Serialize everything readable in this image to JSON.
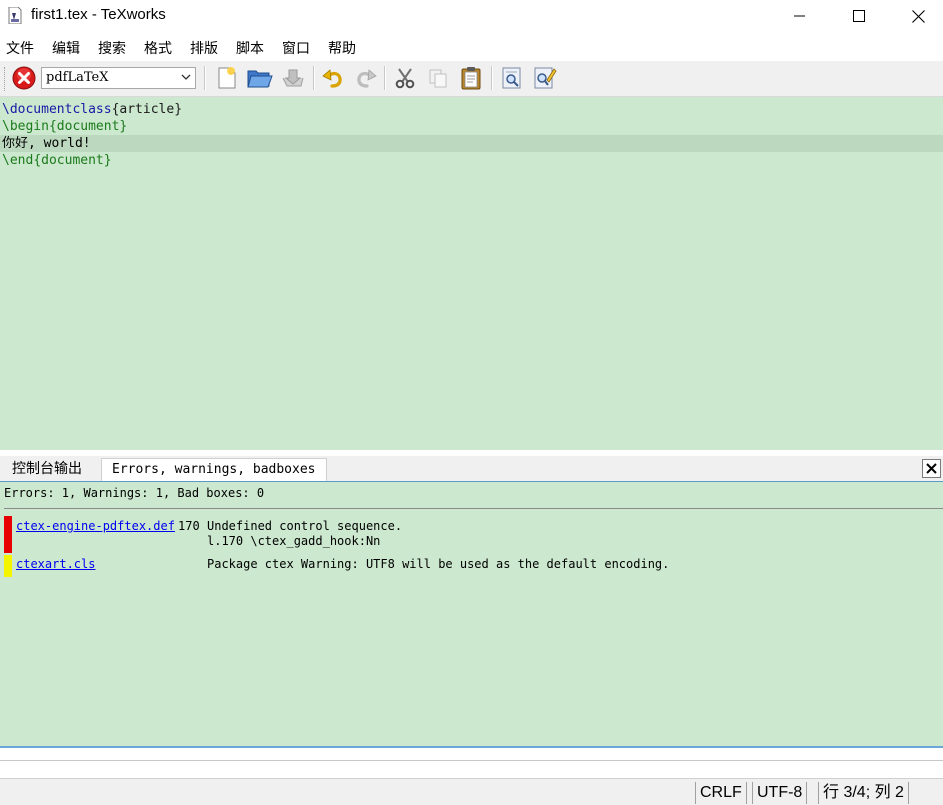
{
  "window": {
    "title": "first1.tex - TeXworks"
  },
  "menu": [
    "文件",
    "编辑",
    "搜索",
    "格式",
    "排版",
    "脚本",
    "窗口",
    "帮助"
  ],
  "toolbar": {
    "engine": "pdfLaTeX",
    "icons": [
      "stop-typeset-icon",
      "new-document-icon",
      "open-folder-icon",
      "save-icon",
      "undo-icon",
      "redo-icon",
      "cut-icon",
      "copy-icon",
      "paste-icon",
      "find-icon",
      "replace-icon"
    ]
  },
  "editor": {
    "lines": [
      {
        "cmd": "\\documentclass",
        "arg": "{article}"
      },
      {
        "cmd": "\\begin",
        "arg": "{document}"
      },
      {
        "text": "你好, world!"
      },
      {
        "cmd": "\\end",
        "arg": "{document}"
      }
    ]
  },
  "panel": {
    "tabs": [
      "控制台输出",
      "Errors, warnings, badboxes"
    ],
    "active_tab": 1,
    "summary": "Errors: 1, Warnings: 1, Bad boxes: 0",
    "entries": [
      {
        "severity": "error",
        "file": "ctex-engine-pdftex.def",
        "line": "170",
        "message": "Undefined control sequence.",
        "detail": "l.170 \\ctex_gadd_hook:Nn"
      },
      {
        "severity": "warning",
        "file": "ctexart.cls",
        "line": "",
        "message": "Package ctex Warning: UTF8 will be used as the default encoding.",
        "detail": ""
      }
    ]
  },
  "colors": {
    "editor_bg": "#cce8cf",
    "error": "#e60000",
    "warning": "#f5f500"
  },
  "status": {
    "line_ending": "CRLF",
    "encoding": "UTF-8",
    "position": "行 3/4; 列 2"
  }
}
